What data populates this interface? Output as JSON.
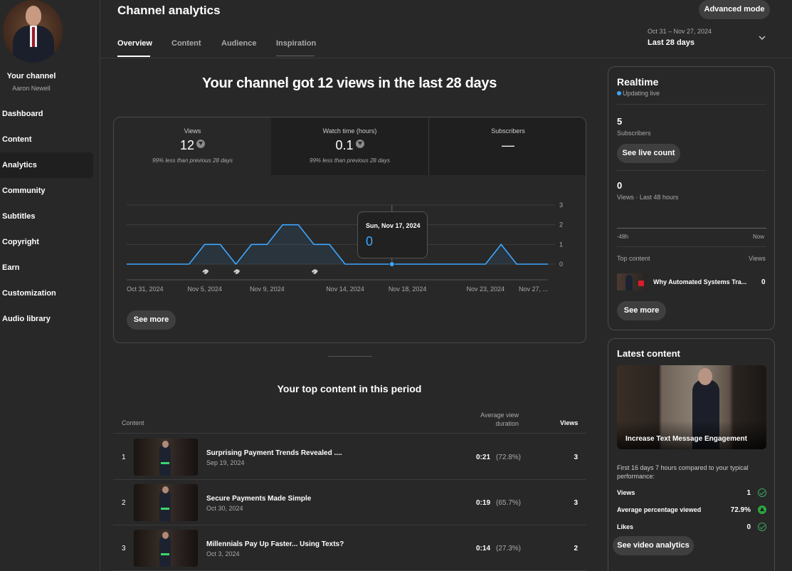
{
  "sidebar": {
    "channel_label": "Your channel",
    "channel_name": "Aaron Newell",
    "items": [
      {
        "label": "Dashboard"
      },
      {
        "label": "Content"
      },
      {
        "label": "Analytics",
        "active": true
      },
      {
        "label": "Community"
      },
      {
        "label": "Subtitles"
      },
      {
        "label": "Copyright"
      },
      {
        "label": "Earn"
      },
      {
        "label": "Customization"
      },
      {
        "label": "Audio library"
      }
    ]
  },
  "header": {
    "title": "Channel analytics",
    "advanced_mode": "Advanced mode",
    "tabs": [
      "Overview",
      "Content",
      "Audience",
      "Inspiration"
    ],
    "active_tab": "Overview",
    "date_range": "Oct 31 – Nov 27, 2024",
    "date_label": "Last 28 days"
  },
  "overview": {
    "headline": "Your channel got 12 views in the last 28 days",
    "metrics": [
      {
        "label": "Views",
        "value": "12",
        "note": "99% less than previous 28 days",
        "trend": "down"
      },
      {
        "label": "Watch time (hours)",
        "value": "0.1",
        "note": "99% less than previous 28 days",
        "trend": "down"
      },
      {
        "label": "Subscribers",
        "value": "—",
        "note": ""
      }
    ],
    "see_more": "See more",
    "tooltip": {
      "date": "Sun, Nov 17, 2024",
      "value": "0"
    }
  },
  "chart_data": {
    "type": "area",
    "x": [
      "Oct 31",
      "Nov 1",
      "Nov 2",
      "Nov 3",
      "Nov 4",
      "Nov 5",
      "Nov 6",
      "Nov 7",
      "Nov 8",
      "Nov 9",
      "Nov 10",
      "Nov 11",
      "Nov 12",
      "Nov 13",
      "Nov 14",
      "Nov 15",
      "Nov 16",
      "Nov 17",
      "Nov 18",
      "Nov 19",
      "Nov 20",
      "Nov 21",
      "Nov 22",
      "Nov 23",
      "Nov 24",
      "Nov 25",
      "Nov 26",
      "Nov 27"
    ],
    "series": [
      {
        "values": [
          0,
          0,
          0,
          0,
          0,
          1,
          1,
          0,
          1,
          1,
          2,
          2,
          1,
          1,
          0,
          0,
          0,
          0,
          0,
          0,
          0,
          0,
          0,
          0,
          1,
          0,
          0,
          0
        ]
      }
    ],
    "x_tick_labels": [
      "Oct 31, 2024",
      "Nov 5, 2024",
      "Nov 9, 2024",
      "Nov 14, 2024",
      "Nov 18, 2024",
      "Nov 23, 2024",
      "Nov 27, ..."
    ],
    "x_tick_index": [
      0,
      5,
      9,
      14,
      18,
      23,
      27
    ],
    "y_ticks": [
      0,
      1,
      2,
      3
    ],
    "ylim": [
      0,
      3
    ],
    "markers_index": [
      5,
      7,
      12
    ],
    "highlight_index": 17,
    "grid": true,
    "line_color": "#3ea6ff"
  },
  "top_content": {
    "title": "Your top content in this period",
    "col_content": "Content",
    "col_avd": "Average view duration",
    "col_views": "Views",
    "rows": [
      {
        "rank": "1",
        "title": "Surprising Payment Trends Revealed ....",
        "date": "Sep 19, 2024",
        "duration": "0:21",
        "pct": "(72.8%)",
        "views": "3"
      },
      {
        "rank": "2",
        "title": "Secure Payments Made Simple",
        "date": "Oct 30, 2024",
        "duration": "0:19",
        "pct": "(65.7%)",
        "views": "3"
      },
      {
        "rank": "3",
        "title": "Millennials Pay Up Faster... Using Texts?",
        "date": "Oct 3, 2024",
        "duration": "0:14",
        "pct": "(27.3%)",
        "views": "2"
      }
    ]
  },
  "realtime": {
    "title": "Realtime",
    "live": "Updating live",
    "subs_value": "5",
    "subs_label": "Subscribers",
    "see_live_count": "See live count",
    "views_value": "0",
    "views_label": "Views · Last 48 hours",
    "tick_left": "-48h",
    "tick_right": "Now",
    "top_content_label": "Top content",
    "views_col": "Views",
    "top_video_title": "Why Automated Systems Tra...",
    "top_video_views": "0",
    "see_more": "See more"
  },
  "latest": {
    "title": "Latest content",
    "video_title": "Increase Text Message Engagement",
    "note": "First 16 days 7 hours compared to your typical performance:",
    "rows": [
      {
        "label": "Views",
        "value": "1",
        "status": "ok"
      },
      {
        "label": "Average percentage viewed",
        "value": "72.9%",
        "status": "up"
      },
      {
        "label": "Likes",
        "value": "0",
        "status": "ok"
      }
    ],
    "see_video_analytics": "See video analytics"
  }
}
